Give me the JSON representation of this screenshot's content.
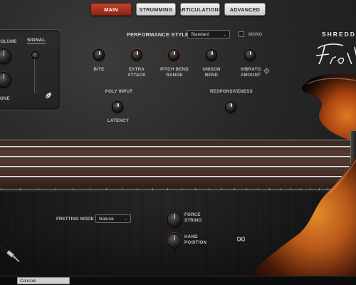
{
  "tabs": [
    {
      "label": "MAIN",
      "active": true
    },
    {
      "label": "STRUMMING",
      "active": false
    },
    {
      "label": "ARTICULATIONS",
      "active": false
    },
    {
      "label": "ADVANCED",
      "active": false
    }
  ],
  "signal": {
    "title": "SIGNAL",
    "volume_label": "VOLUME",
    "tone_label": "TONE"
  },
  "performance": {
    "style_label": "PERFORMANCE STYLE",
    "style_value": "Standard",
    "mono_label": "MONO",
    "mono_checked": false
  },
  "knobs": {
    "bite": "BITE",
    "extra_attack_1": "EXTRA",
    "extra_attack_2": "ATTACK",
    "pitch_bend_1": "PITCH BEND",
    "pitch_bend_2": "RANGE",
    "unison_bend_1": "UNISON",
    "unison_bend_2": "BEND",
    "vibrato_1": "VIBRATO",
    "vibrato_2": "AMOUNT",
    "poly_input": "POLY INPUT",
    "latency": "LATENCY",
    "responsiveness": "RESPONSIVENESS"
  },
  "logo": {
    "brand": "SHREDDAGE",
    "product": "Fretless"
  },
  "fretboard": {
    "string_count": 4
  },
  "bottom": {
    "fretting_mode_label": "FRETTING MODE",
    "fretting_mode_value": "Natural",
    "force_string_1": "FORCE",
    "force_string_2": "STRING",
    "hand_position_1": "HAND",
    "hand_position_2": "POSITION"
  },
  "console": {
    "tab_label": "Console"
  },
  "colors": {
    "accent": "#b03a24",
    "background": "#262626",
    "fretboard": "#4a322a",
    "guitar_body": "#c06a1e"
  }
}
